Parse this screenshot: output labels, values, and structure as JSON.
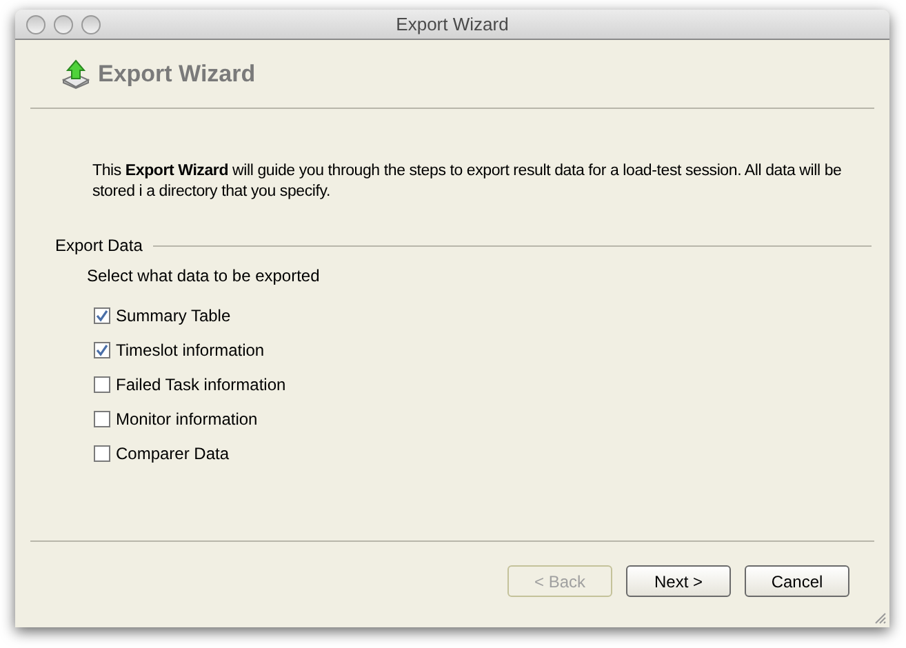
{
  "window": {
    "title": "Export Wizard"
  },
  "header": {
    "title": "Export Wizard"
  },
  "intro": "This **Export Wizard** will guide you through the steps to export result data for a load-test session. All data will be stored i a directory that you specify.",
  "section": {
    "title": "Export Data",
    "instruction": "Select what data to be exported",
    "options": [
      {
        "label": "Summary Table",
        "checked": true
      },
      {
        "label": "Timeslot information",
        "checked": true
      },
      {
        "label": "Failed Task information",
        "checked": false
      },
      {
        "label": "Monitor information",
        "checked": false
      },
      {
        "label": "Comparer Data",
        "checked": false
      }
    ]
  },
  "buttons": [
    {
      "label": "< Back",
      "disabled": true
    },
    {
      "label": "Next >",
      "disabled": false
    },
    {
      "label": "Cancel",
      "disabled": false
    }
  ]
}
